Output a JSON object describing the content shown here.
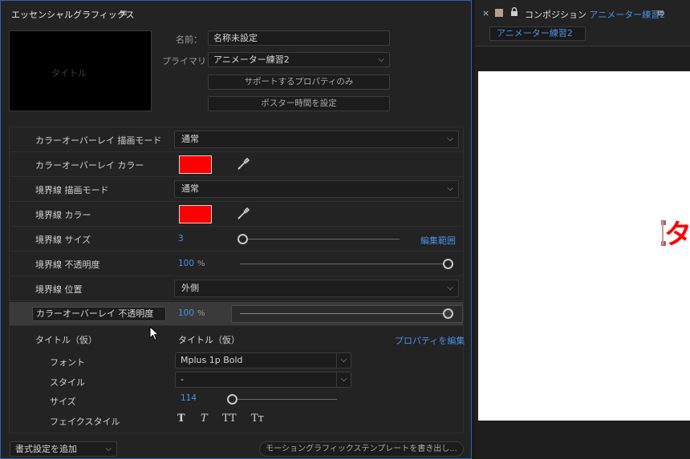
{
  "essential_graphics": {
    "panel_title": "エッセンシャルグラフィックス",
    "thumbnail_text": "タイトル",
    "name_label": "名前：",
    "name_value": "名称未設定",
    "primary_label": "プライマリ：",
    "primary_value": "アニメーター練習2",
    "supported_props_button": "サポートするプロパティのみ",
    "poster_time_button": "ポスター時間を設定",
    "properties": [
      {
        "label": "カラーオーバーレイ 描画モード",
        "value": "通常"
      },
      {
        "label": "カラーオーバーレイ カラー",
        "color": "#ff0000"
      },
      {
        "label": "境界線 描画モード",
        "value": "通常"
      },
      {
        "label": "境界線 カラー",
        "color": "#ff0000"
      },
      {
        "label": "境界線 サイズ",
        "value": "3",
        "link": "編集範囲",
        "fraction": 0.0
      },
      {
        "label": "境界線 不透明度",
        "value": "100",
        "unit": "%",
        "fraction": 1.0
      },
      {
        "label": "境界線 位置",
        "value": "外側"
      },
      {
        "label": "カラーオーバーレイ 不透明度",
        "value": "100",
        "unit": "%",
        "fraction": 1.0
      }
    ],
    "text_group": {
      "label": "タイトル（仮）",
      "value": "タイトル（仮）",
      "edit_link": "プロパティを編集",
      "font_label": "フォント",
      "font_value": "Mplus 1p Bold",
      "style_label": "スタイル",
      "style_value": "-",
      "size_label": "サイズ",
      "size_value": "114",
      "faux_label": "フェイクスタイル",
      "faux_buttons": [
        "T",
        "T",
        "TT",
        "Tт"
      ]
    },
    "add_formatting": "書式設定を追加",
    "export_button": "モーショングラフィックステンプレートを書き出し..."
  },
  "composition": {
    "panel_title": "コンポジション",
    "comp_name": "アニメーター練習2",
    "tab_label": "アニメーター練習2",
    "preview_glyph": "タ",
    "accent": "#4a90e6"
  }
}
